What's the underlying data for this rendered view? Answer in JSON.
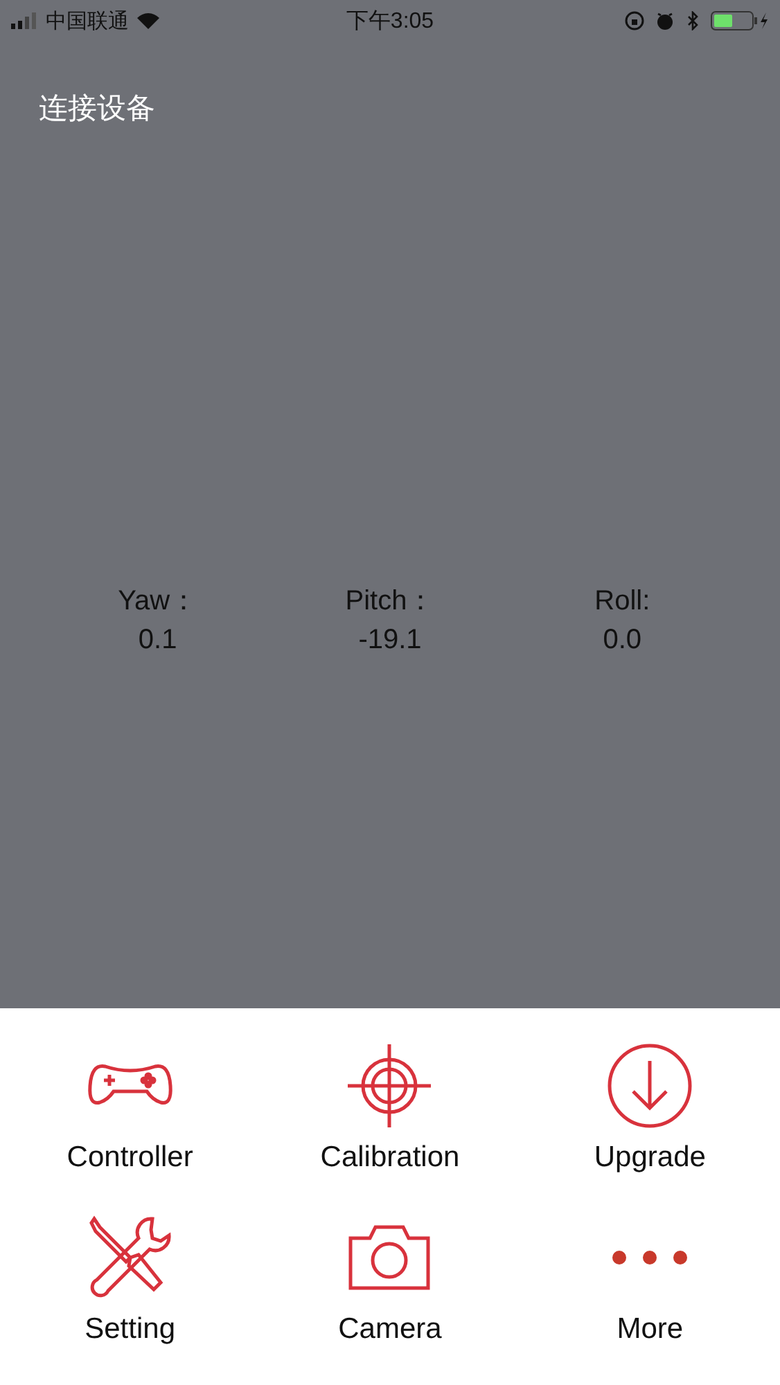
{
  "status_bar": {
    "carrier": "中国联通",
    "time": "下午3:05"
  },
  "header": {
    "title": "连接设备"
  },
  "readings": [
    {
      "label": "Yaw：",
      "value": "0.1"
    },
    {
      "label": "Pitch：",
      "value": "-19.1"
    },
    {
      "label": "Roll:",
      "value": "0.0"
    }
  ],
  "menu": [
    {
      "kind": "controller",
      "label": "Controller"
    },
    {
      "kind": "target",
      "label": "Calibration"
    },
    {
      "kind": "download",
      "label": "Upgrade"
    },
    {
      "kind": "tools",
      "label": "Setting"
    },
    {
      "kind": "camera",
      "label": "Camera"
    },
    {
      "kind": "more",
      "label": "More"
    }
  ]
}
